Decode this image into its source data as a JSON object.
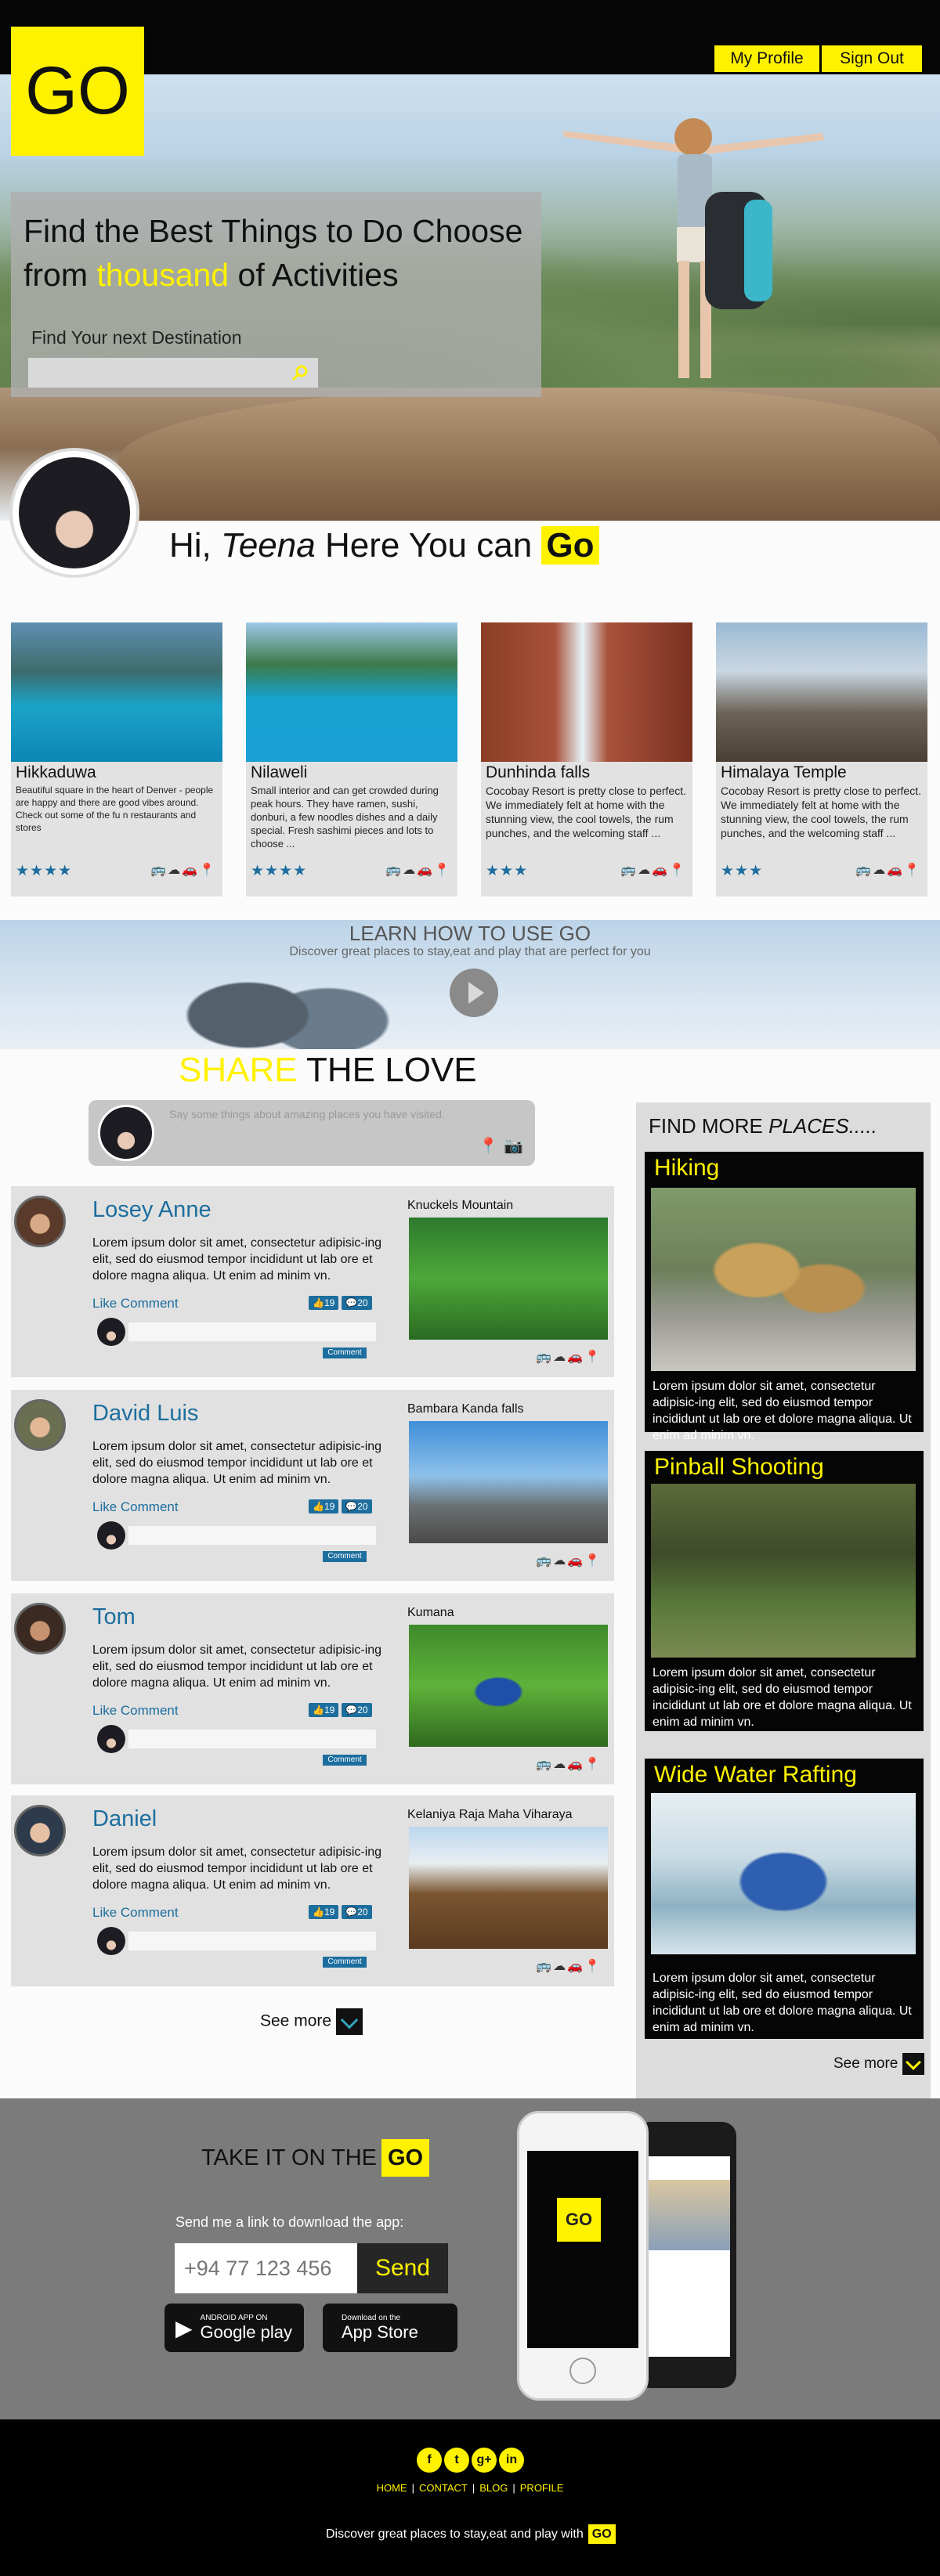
{
  "header": {
    "logo": "GO",
    "my_profile": "My Profile",
    "sign_out": "Sign Out"
  },
  "hero": {
    "title_part1": "Find the Best Things to Do Choose from ",
    "title_highlight": "thousand",
    "title_part2": " of Activities",
    "search_label": "Find Your next Destination",
    "search_placeholder": ""
  },
  "greeting": {
    "hi": "Hi, ",
    "name": "Teena",
    "rest": " Here You can ",
    "go": "Go"
  },
  "cards": [
    {
      "title": "Hikkaduwa",
      "text": "Beautiful square in the heart of Denver - people are happy and there are good vibes around. Check out some of the fu n restaurants and stores",
      "stars": "★★★★",
      "amenities": "🚌☁🚗📍"
    },
    {
      "title": "Nilaweli",
      "text": "Small interior and can get crowded during peak hours. They have ramen, sushi, donburi, a few noodles dishes and a daily special. Fresh sashimi pieces and lots to choose ...",
      "stars": "★★★★",
      "amenities": "🚌☁🚗📍"
    },
    {
      "title": "Dunhinda falls",
      "text": "Cocobay Resort is pretty close to perfect. We immediately felt at home with the stunning view, the cool towels, the rum punches, and the welcoming staff ...",
      "stars": "★★★",
      "amenities": "🚌☁🚗📍"
    },
    {
      "title": "Himalaya Temple",
      "text": "Cocobay Resort is pretty close to perfect. We immediately felt at home with the stunning view, the cool towels, the rum punches, and the welcoming staff ...",
      "stars": "★★★",
      "amenities": "🚌☁🚗📍"
    }
  ],
  "learn": {
    "title": "LEARN HOW TO USE GO",
    "subtitle": "Discover great places to stay,eat and play that are perfect for you"
  },
  "share": {
    "yellow": "SHARE",
    "rest": " THE LOVE",
    "placeholder": "Say some things about amazing places you have visited.",
    "icon1": "📍",
    "icon2": "📷"
  },
  "posts": [
    {
      "name": "Losey Anne",
      "text": "Lorem ipsum dolor sit amet, consectetur adipisic-ing elit, sed do eiusmod tempor incididunt ut lab ore et dolore magna aliqua. Ut enim ad minim vn.",
      "actions": "Like  Comment",
      "likes": "👍19",
      "comments": "💬20",
      "comment_btn": "Comment",
      "place": "Knuckels Mountain",
      "amenities": "🚌☁🚗📍"
    },
    {
      "name": "David Luis",
      "text": "Lorem ipsum dolor sit amet, consectetur adipisic-ing elit, sed do eiusmod tempor incididunt ut lab ore et dolore magna aliqua. Ut enim ad minim vn.",
      "actions": "Like  Comment",
      "likes": "👍19",
      "comments": "💬20",
      "comment_btn": "Comment",
      "place": "Bambara Kanda falls",
      "amenities": "🚌☁🚗📍"
    },
    {
      "name": "Tom",
      "text": "Lorem ipsum dolor sit amet, consectetur adipisic-ing elit, sed do eiusmod tempor incididunt ut lab ore et dolore magna aliqua. Ut enim ad minim vn.",
      "actions": "Like  Comment",
      "likes": "👍19",
      "comments": "💬20",
      "comment_btn": "Comment",
      "place": "Kumana",
      "amenities": "🚌☁🚗📍"
    },
    {
      "name": "Daniel",
      "text": "Lorem ipsum dolor sit amet, consectetur adipisic-ing elit, sed do eiusmod tempor incididunt ut lab ore et dolore magna aliqua. Ut enim ad minim vn.",
      "actions": "Like  Comment",
      "likes": "👍19",
      "comments": "💬20",
      "comment_btn": "Comment",
      "place": "Kelaniya Raja Maha Viharaya",
      "amenities": "🚌☁🚗📍"
    }
  ],
  "see_more": "See more",
  "sidebar": {
    "title_plain": "FIND MORE ",
    "title_italic": "PLACES.....",
    "places": [
      {
        "title": "Hiking",
        "text": "Lorem ipsum dolor sit amet, consectetur adipisic-ing elit, sed do eiusmod tempor incididunt ut lab ore et dolore magna aliqua. Ut enim ad minim vn."
      },
      {
        "title": "Pinball Shooting",
        "text": "Lorem ipsum dolor sit amet, consectetur adipisic-ing elit, sed do eiusmod tempor incididunt ut lab ore et dolore magna aliqua. Ut enim ad minim vn."
      },
      {
        "title": "Wide Water Rafting",
        "text": "Lorem ipsum dolor sit amet, consectetur adipisic-ing elit, sed do eiusmod tempor incididunt ut lab ore et dolore magna aliqua. Ut enim ad minim vn."
      }
    ],
    "see_more": "See more"
  },
  "app": {
    "title": "TAKE IT ON THE",
    "go": "GO",
    "sub": "Send me a link to download the app:",
    "phone_placeholder": "+94 77 123 456",
    "send": "Send",
    "google_small": "ANDROID APP ON",
    "google_big": "Google play",
    "apple_small": "Download on the",
    "apple_big": "App Store",
    "phone_logo": "GO"
  },
  "footer": {
    "social": [
      "f",
      "t",
      "g+",
      "in"
    ],
    "nav": [
      "HOME",
      "CONTACT",
      "BLOG",
      "PROFILE"
    ],
    "tagline": "Discover great places to stay,eat and play with",
    "go": "GO"
  },
  "colors": {
    "accent": "#fff200",
    "link": "#1c6e9e",
    "dark": "#050505"
  }
}
